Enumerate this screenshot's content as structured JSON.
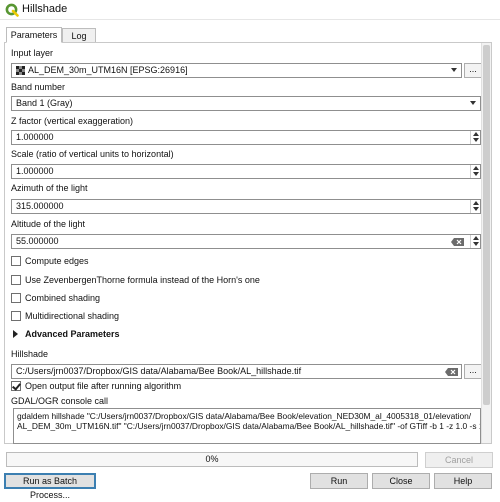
{
  "window": {
    "title": "Hillshade"
  },
  "tabs": [
    {
      "label": "Parameters"
    },
    {
      "label": "Log"
    }
  ],
  "params": {
    "input_layer": {
      "label": "Input layer",
      "value": "AL_DEM_30m_UTM16N [EPSG:26916]",
      "button": "..."
    },
    "band_number": {
      "label": "Band number",
      "value": "Band 1 (Gray)"
    },
    "z_factor": {
      "label": "Z factor (vertical exaggeration)",
      "value": "1.000000"
    },
    "scale": {
      "label": "Scale (ratio of vertical units to horizontal)",
      "value": "1.000000"
    },
    "azimuth": {
      "label": "Azimuth of the light",
      "value": "315.000000"
    },
    "altitude": {
      "label": "Altitude of the light",
      "value": "55.000000"
    },
    "checkboxes": [
      {
        "label": "Compute edges",
        "checked": false
      },
      {
        "label": "Use ZevenbergenThorne formula instead of the Horn's one",
        "checked": false
      },
      {
        "label": "Combined shading",
        "checked": false
      },
      {
        "label": "Multidirectional shading",
        "checked": false
      }
    ],
    "advanced": {
      "label": "Advanced Parameters"
    },
    "hillshade": {
      "label": "Hillshade",
      "value": "C:/Users/jrn0037/Dropbox/GIS data/Alabama/Bee Book/AL_hillshade.tif",
      "button": "..."
    },
    "open_output": {
      "label": "Open output file after running algorithm",
      "checked": true
    },
    "console": {
      "label": "GDAL/OGR console call",
      "lines": [
        "gdaldem hillshade \"C:/Users/jrn0037/Dropbox/GIS data/Alabama/Bee Book/elevation_NED30M_al_4005318_01/elevation/",
        "AL_DEM_30m_UTM16N.tif\" \"C:/Users/jrn0037/Dropbox/GIS data/Alabama/Bee Book/AL_hillshade.tif\" -of GTiff -b 1 -z 1.0 -s 1.0 -az"
      ]
    }
  },
  "progress": {
    "value": 0,
    "text": "0%",
    "fill_color": "#06b025"
  },
  "buttons": {
    "cancel": "Cancel",
    "batch": "Run as Batch Process...",
    "run": "Run",
    "close": "Close",
    "help": "Help"
  },
  "icons": {
    "app": "qgis-logo-icon",
    "layer": "raster-layer-icon",
    "clear": "clear-field-icon"
  },
  "colors": {
    "qgis_green": "#589632",
    "qgis_yellow": "#eec900",
    "focus_border": "#3c7fb1"
  }
}
